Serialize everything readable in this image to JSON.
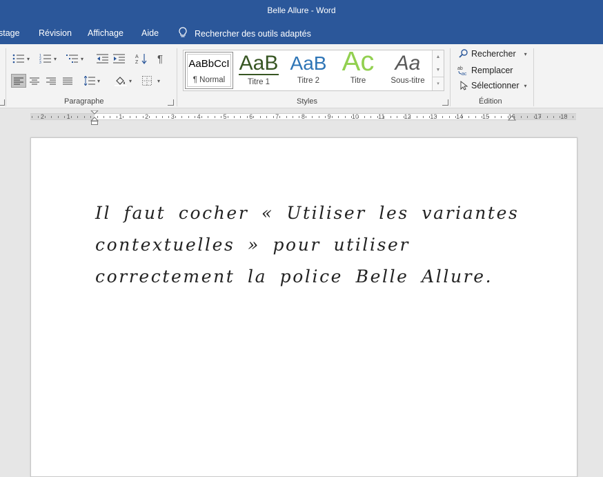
{
  "window": {
    "title": "Belle Allure  -  Word"
  },
  "tabs": [
    {
      "label": "stage"
    },
    {
      "label": "Révision"
    },
    {
      "label": "Affichage"
    },
    {
      "label": "Aide"
    }
  ],
  "tell_me": {
    "label": "Rechercher des outils adaptés"
  },
  "ribbon": {
    "paragraph_label": "Paragraphe",
    "styles_label": "Styles",
    "editing_label": "Édition",
    "styles": [
      {
        "preview": "AaBbCcI",
        "name": "¶ Normal",
        "color": "#000000"
      },
      {
        "preview": "AaB",
        "name": "Titre 1",
        "color": "#375623"
      },
      {
        "preview": "AaB",
        "name": "Titre 2",
        "color": "#2e75b6"
      },
      {
        "preview": "Ac",
        "name": "Titre",
        "color": "#92d050"
      },
      {
        "preview": "Aa",
        "name": "Sous-titre",
        "color": "#595959"
      }
    ],
    "editing": {
      "find": "Rechercher",
      "replace": "Remplacer",
      "select": "Sélectionner"
    }
  },
  "ruler": {
    "numbers": [
      "2",
      "1",
      "1",
      "2",
      "3",
      "4",
      "5",
      "6",
      "7",
      "8",
      "9",
      "10",
      "11",
      "12",
      "13",
      "14",
      "15",
      "16",
      "17",
      "18"
    ]
  },
  "document": {
    "text": "Il faut cocher « Utiliser les variantes contextuelles » pour utiliser correctement la police Belle Allure."
  },
  "colors": {
    "accent": "#2b579a"
  }
}
